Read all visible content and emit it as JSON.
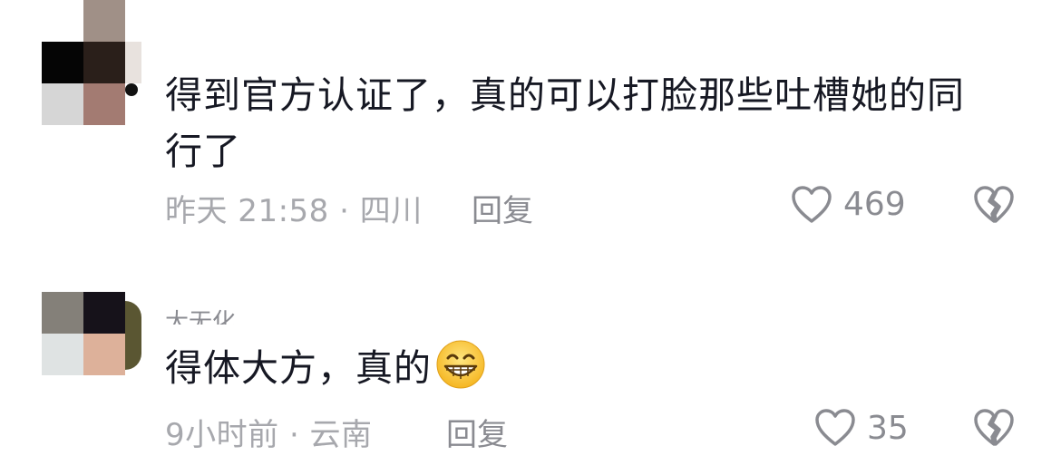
{
  "comments": [
    {
      "text": "得到官方认证了，真的可以打脸那些吐槽她的同行了",
      "meta": "昨天 21:58 · 四川",
      "reply_label": "回复",
      "like_count": "469",
      "icons": {
        "like": "heart-outline-icon",
        "dislike": "broken-heart-icon"
      }
    },
    {
      "username": "大无化",
      "text": "得体大方，真的",
      "emoji": "grinning-face-icon",
      "meta": "9小时前 · 云南",
      "reply_label": "回复",
      "like_count": "35",
      "icons": {
        "like": "heart-outline-icon",
        "dislike": "broken-heart-icon"
      }
    }
  ],
  "colors": {
    "text_primary": "#161823",
    "text_secondary": "#a7a8ad",
    "icon_gray": "#8a8b91"
  }
}
